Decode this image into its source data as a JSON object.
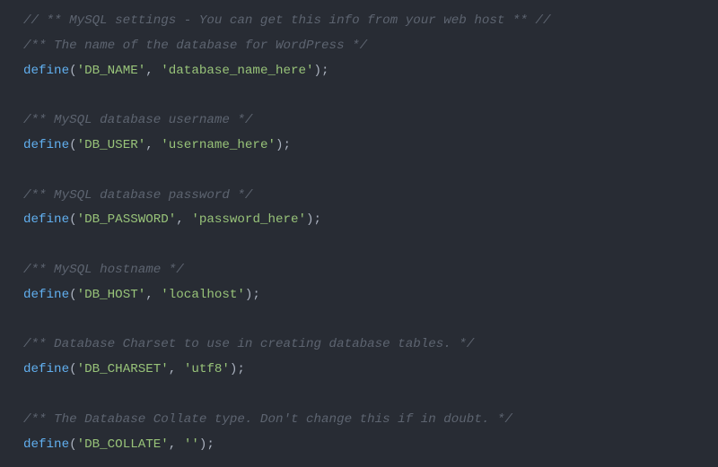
{
  "code": {
    "comment_header": "// ** MySQL settings - You can get this info from your web host ** //",
    "c_db_name": "/** The name of the database for WordPress */",
    "c_db_user": "/** MySQL database username */",
    "c_db_pass": "/** MySQL database password */",
    "c_db_host": "/** MySQL hostname */",
    "c_db_charset": "/** Database Charset to use in creating database tables. */",
    "c_db_collate": "/** The Database Collate type. Don't change this if in doubt. */",
    "fn": "define",
    "paren_open": "(",
    "paren_close_semi": ");",
    "comma_sp": ", ",
    "s_db_name_key": "'DB_NAME'",
    "s_db_name_val": "'database_name_here'",
    "s_db_user_key": "'DB_USER'",
    "s_db_user_val": "'username_here'",
    "s_db_pass_key": "'DB_PASSWORD'",
    "s_db_pass_val": "'password_here'",
    "s_db_host_key": "'DB_HOST'",
    "s_db_host_val": "'localhost'",
    "s_db_charset_key": "'DB_CHARSET'",
    "s_db_charset_val": "'utf8'",
    "s_db_collate_key": "'DB_COLLATE'",
    "s_db_collate_val": "''"
  }
}
